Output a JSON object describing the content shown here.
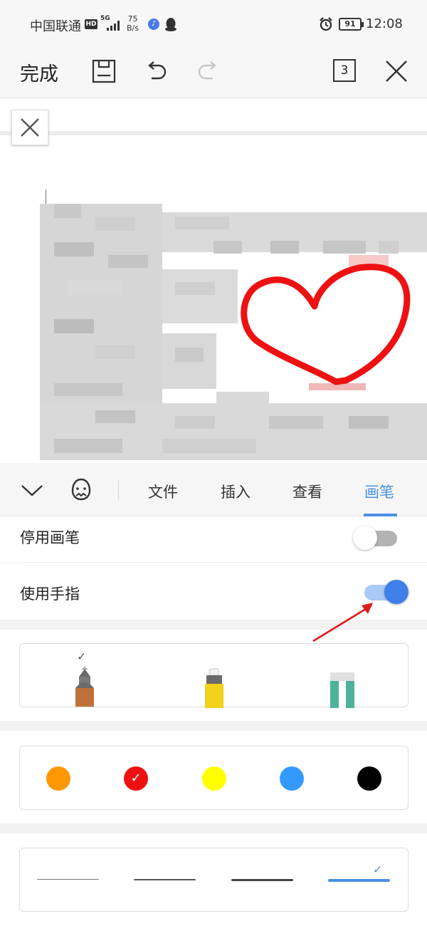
{
  "status_bar": {
    "carrier": "中国联通",
    "hd_badge": "HD",
    "network": "5G",
    "speed_value": "75",
    "speed_unit": "B/s",
    "battery": "91",
    "time": "12:08"
  },
  "toolbar": {
    "done_label": "完成",
    "page_count": "3",
    "icons": [
      "save-icon",
      "undo-icon",
      "redo-icon",
      "page-count",
      "close-icon"
    ]
  },
  "tabs": {
    "items": [
      {
        "label": "文件"
      },
      {
        "label": "插入"
      },
      {
        "label": "查看"
      },
      {
        "label": "画笔"
      }
    ],
    "active": "画笔"
  },
  "settings": {
    "disable_pen": {
      "label": "停用画笔",
      "enabled": false
    },
    "use_finger": {
      "label": "使用手指",
      "enabled": true
    }
  },
  "pen_tools": [
    {
      "name": "pencil",
      "selected": true
    },
    {
      "name": "highlighter",
      "selected": false
    },
    {
      "name": "eraser",
      "selected": false
    }
  ],
  "colors": [
    {
      "name": "orange",
      "hex": "#ff9800",
      "selected": false
    },
    {
      "name": "red",
      "hex": "#ee1111",
      "selected": true
    },
    {
      "name": "yellow",
      "hex": "#ffff00",
      "selected": false
    },
    {
      "name": "blue",
      "hex": "#3399ff",
      "selected": false
    },
    {
      "name": "black",
      "hex": "#000000",
      "selected": false
    }
  ],
  "stroke_widths": [
    {
      "name": "thin",
      "selected": false
    },
    {
      "name": "medium",
      "selected": false
    },
    {
      "name": "thick",
      "selected": false
    },
    {
      "name": "extra-thick",
      "selected": true
    }
  ],
  "accent_color": "#4a90e2"
}
